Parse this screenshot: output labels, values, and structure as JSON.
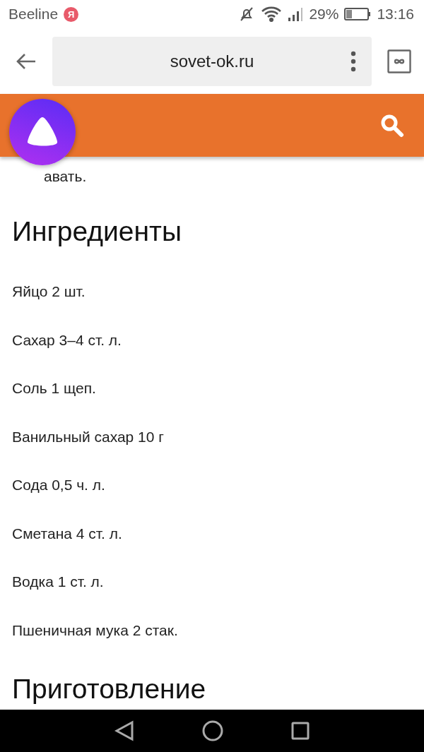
{
  "status_bar": {
    "carrier": "Beeline",
    "badge": "Я",
    "battery": "29%",
    "time": "13:16"
  },
  "browser": {
    "url": "sovet-ok.ru"
  },
  "article": {
    "partial_line": "авать.",
    "sections": [
      {
        "heading": "Ингредиенты",
        "items": [
          "Яйцо 2 шт.",
          "Сахар 3–4 ст. л.",
          "Соль 1 щеп.",
          "Ванильный сахар 10 г",
          "Сода 0,5 ч. л.",
          "Сметана 4 ст. л.",
          "Водка 1 ст. л.",
          "Пшеничная мука 2 стак."
        ]
      },
      {
        "heading": "Приготовление"
      }
    ]
  }
}
